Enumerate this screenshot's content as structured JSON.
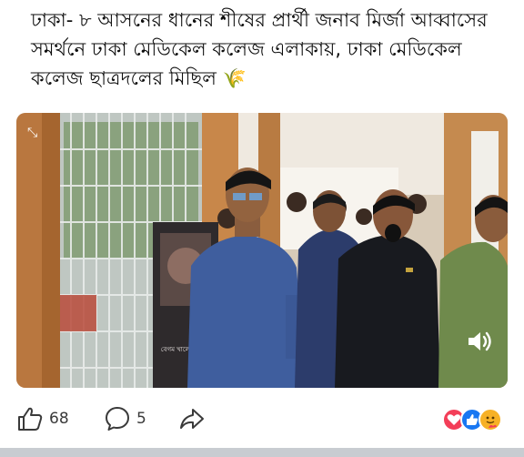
{
  "post": {
    "text": "ঢাকা- ৮ আসনের ধানের শীষের প্রার্থী জনাব মির্জা আব্বাসের সমর্থনে ঢাকা মেডিকেল কলেজ এলাকায়, ঢাকা মেডিকেল কলেজ ছাত্রদলের মিছিল 🌾"
  },
  "media": {
    "poster_caption": "বেগম খালেদা জিয়া"
  },
  "actions": {
    "like_count": "68",
    "comment_count": "5"
  },
  "colors": {
    "like_blue": "#1877f2",
    "love_red": "#f33e58",
    "haha_yellow": "#f7b125",
    "icon_gray": "#3a3a3a"
  },
  "icons": {
    "like": "thumbs-up-icon",
    "comment": "speech-bubble-icon",
    "share": "share-arrow-icon",
    "volume": "speaker-icon"
  }
}
